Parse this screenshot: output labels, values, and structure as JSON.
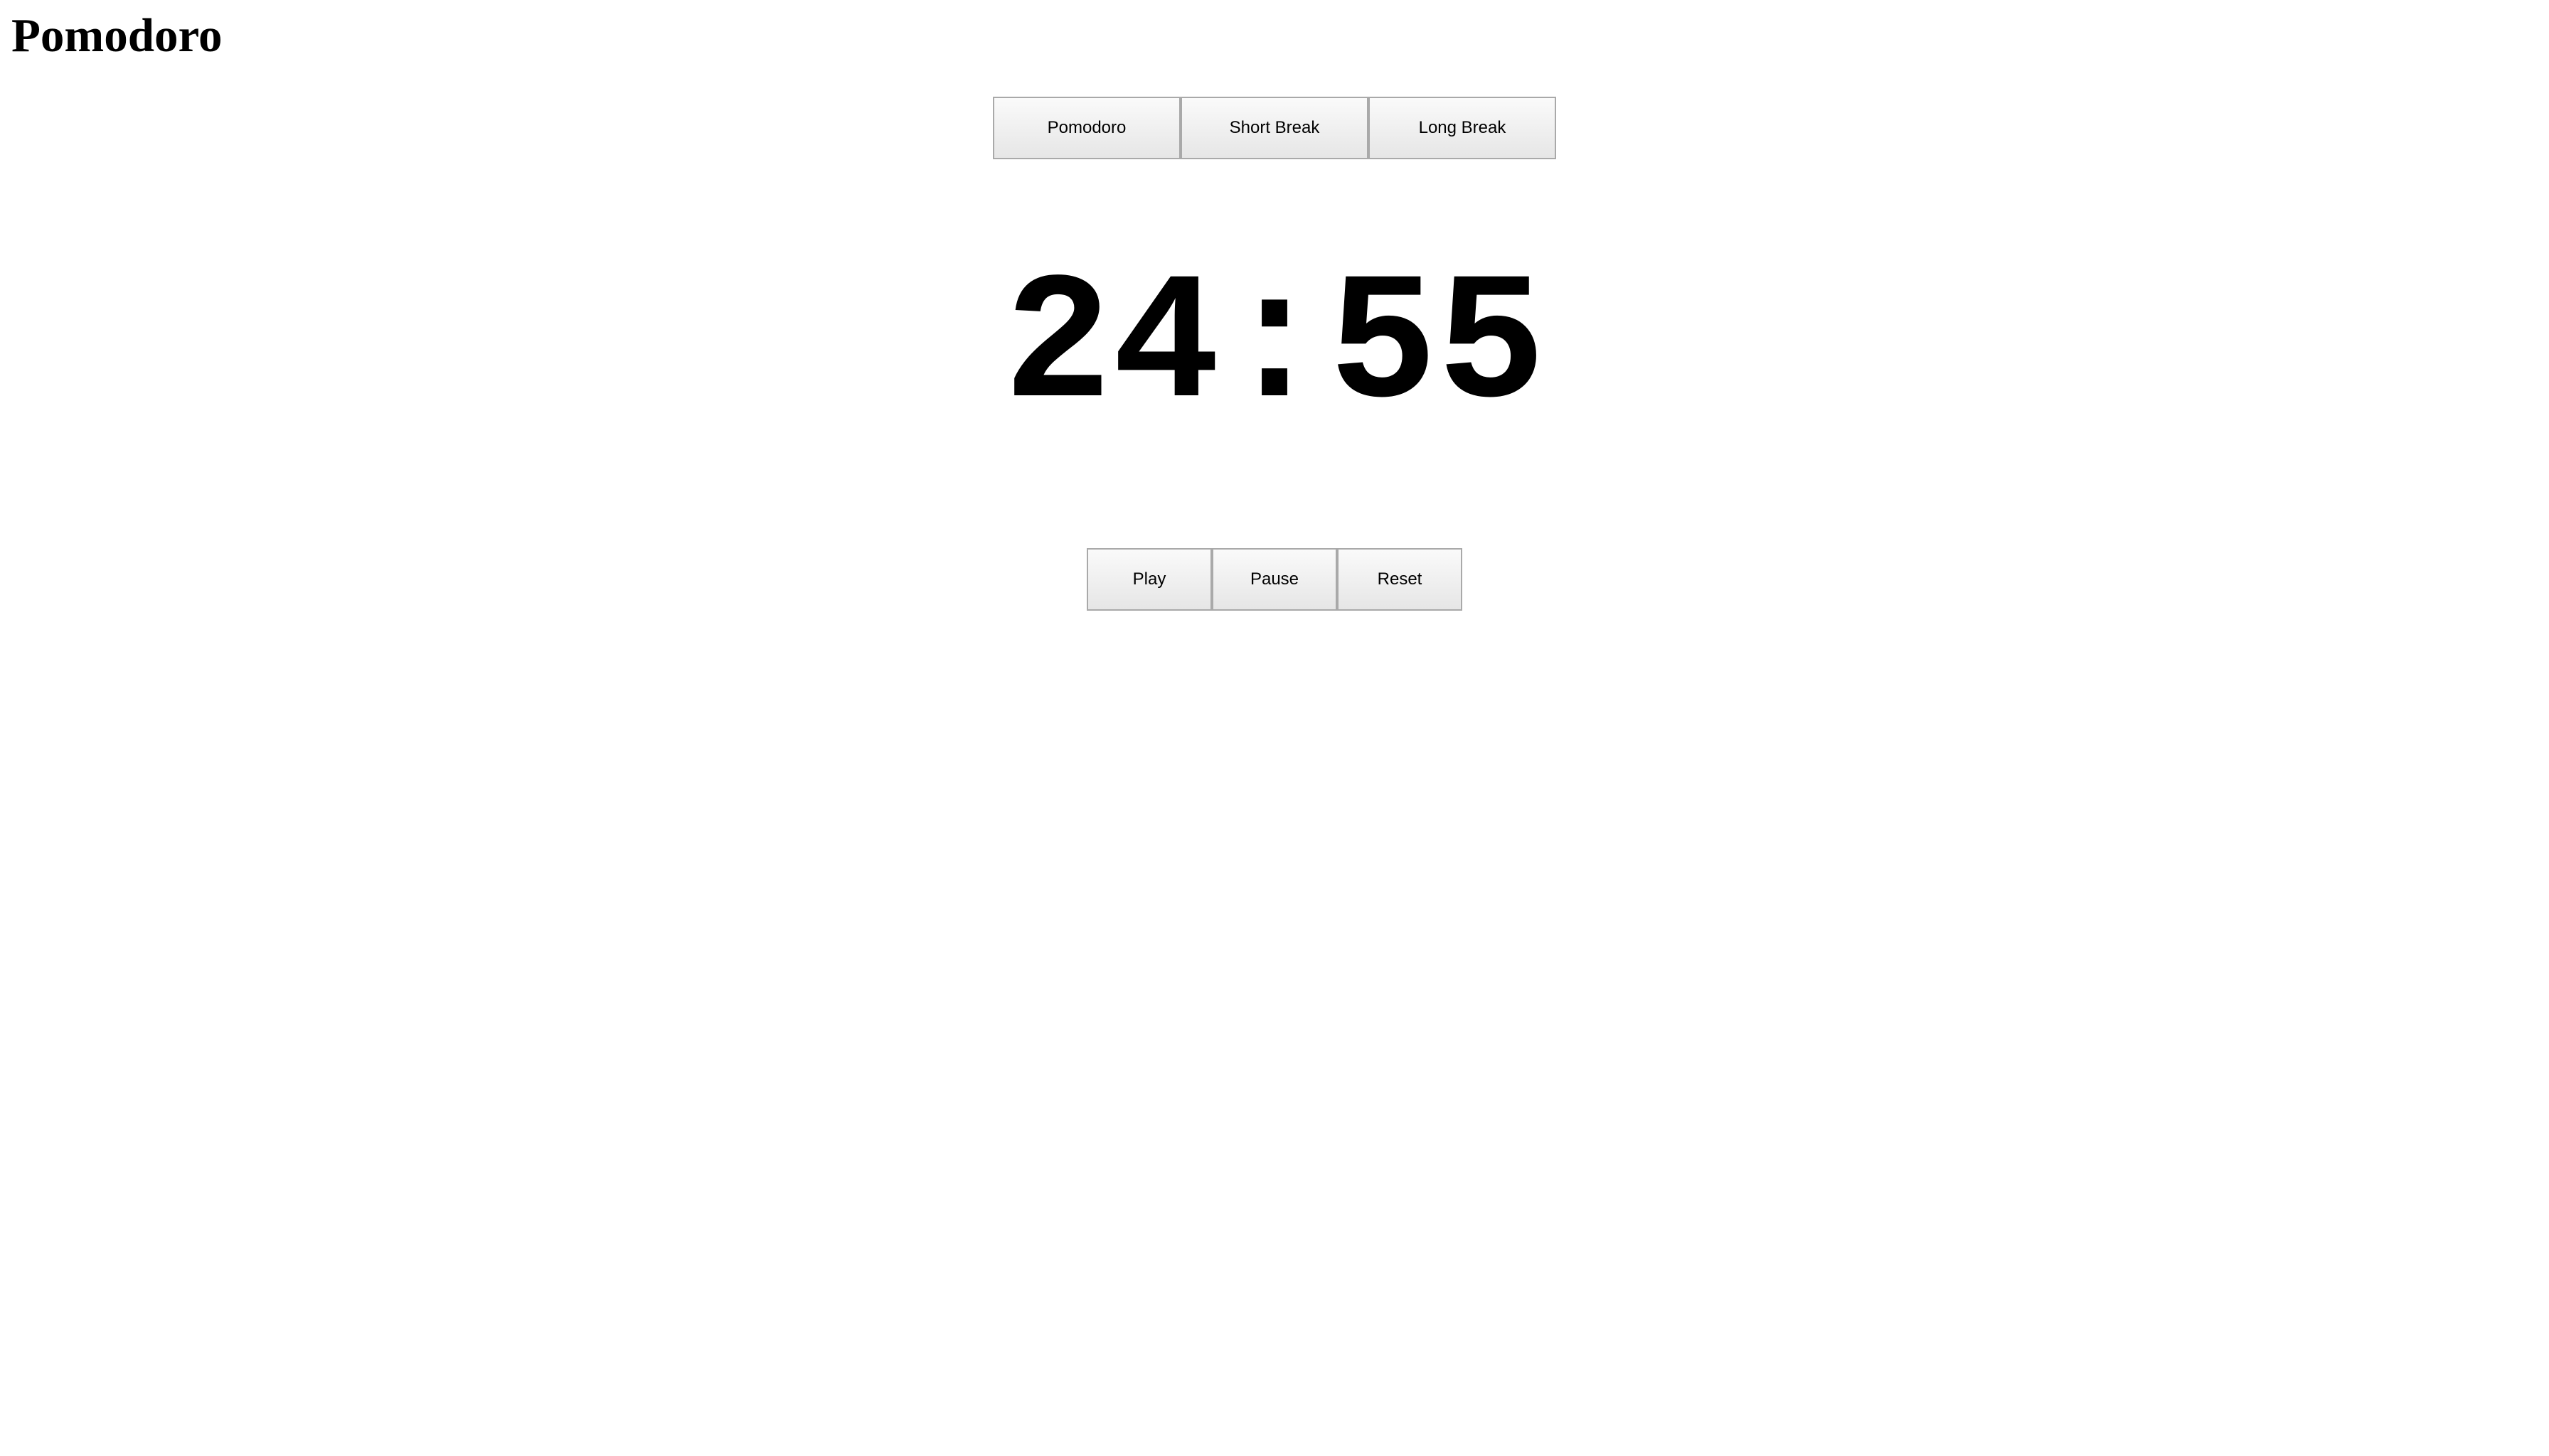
{
  "page": {
    "title": "Pomodoro"
  },
  "modes": {
    "items": [
      {
        "id": "pomodoro",
        "label": "Pomodoro"
      },
      {
        "id": "short-break",
        "label": "Short Break"
      },
      {
        "id": "long-break",
        "label": "Long Break"
      }
    ]
  },
  "timer": {
    "display": "24:55"
  },
  "controls": {
    "play_label": "Play",
    "pause_label": "Pause",
    "reset_label": "Reset"
  },
  "colors": {
    "background": "#ffffff",
    "text": "#000000",
    "button_border": "#a9a9a9",
    "button_face": "#f0f0f0"
  }
}
